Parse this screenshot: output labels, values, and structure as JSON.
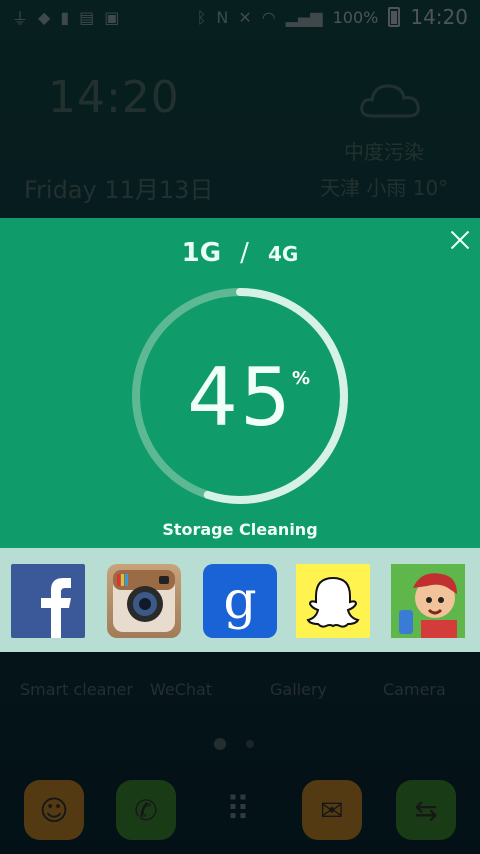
{
  "status_bar": {
    "battery_percent": "100%",
    "time": "14:20",
    "network_letter": "N"
  },
  "lockscreen_widget": {
    "clock": "14:20",
    "date": "Friday  11月13日",
    "air_quality": "中度污染",
    "weather": "天津 小雨 10°"
  },
  "cleaner_card": {
    "memory_used": "1G",
    "memory_separator": "/",
    "memory_total": "4G",
    "percent_value": "45",
    "percent_sign": "%",
    "progress_fraction": 0.55,
    "label": "Storage Cleaning",
    "colors": {
      "background": "#0f9b6a",
      "ring_track": "#5db894",
      "ring_fill": "#d6f1e6"
    }
  },
  "app_strip": [
    {
      "name": "facebook-app-icon"
    },
    {
      "name": "instagram-app-icon"
    },
    {
      "name": "google-app-icon"
    },
    {
      "name": "snapchat-app-icon"
    },
    {
      "name": "subway-surfers-app-icon"
    }
  ],
  "home_labels": [
    "Smart cleaner",
    "WeChat",
    "Gallery",
    "Camera"
  ],
  "dock": [
    "contacts-icon",
    "phone-icon",
    "apps-grid-icon",
    "messages-icon",
    "dual-phone-icon"
  ]
}
